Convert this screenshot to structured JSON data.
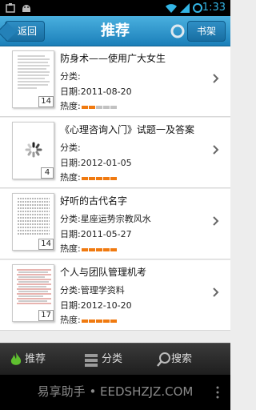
{
  "status_bar": {
    "time": "1:33"
  },
  "header": {
    "back_label": "返回",
    "title": "推荐",
    "shelf_label": "书架"
  },
  "labels": {
    "category": "分类:",
    "date": "日期:",
    "heat": "热度:"
  },
  "colors": {
    "heat_on": "#f07a10",
    "heat_off": "#c2c2c2",
    "accent": "#33b5e5"
  },
  "items": [
    {
      "title": "防身术——使用广大女生",
      "category": "",
      "date": "2011-08-20",
      "pages": "14",
      "heat": [
        1,
        1,
        0,
        0,
        0
      ],
      "thumb": "doc"
    },
    {
      "title": "《心理咨询入门》试题一及答案",
      "category": "",
      "date": "2012-01-05",
      "pages": "4",
      "heat": [
        1,
        1,
        1,
        1,
        1
      ],
      "thumb": "loading"
    },
    {
      "title": "好听的古代名字",
      "category": "星座运势宗教风水",
      "date": "2011-05-27",
      "pages": "14",
      "heat": [
        1,
        1,
        1,
        1,
        1
      ],
      "thumb": "doc"
    },
    {
      "title": "个人与团队管理机考",
      "category": "管理学资料",
      "date": "2012-10-20",
      "pages": "17",
      "heat": [
        1,
        1,
        1,
        1,
        1
      ],
      "thumb": "doc-red"
    }
  ],
  "bottom_nav": [
    {
      "label": "推荐",
      "icon": "flame-icon"
    },
    {
      "label": "分类",
      "icon": "category-icon"
    },
    {
      "label": "搜索",
      "icon": "search-icon"
    }
  ],
  "watermark": "易享助手 • EEDSHZJZ.COM"
}
